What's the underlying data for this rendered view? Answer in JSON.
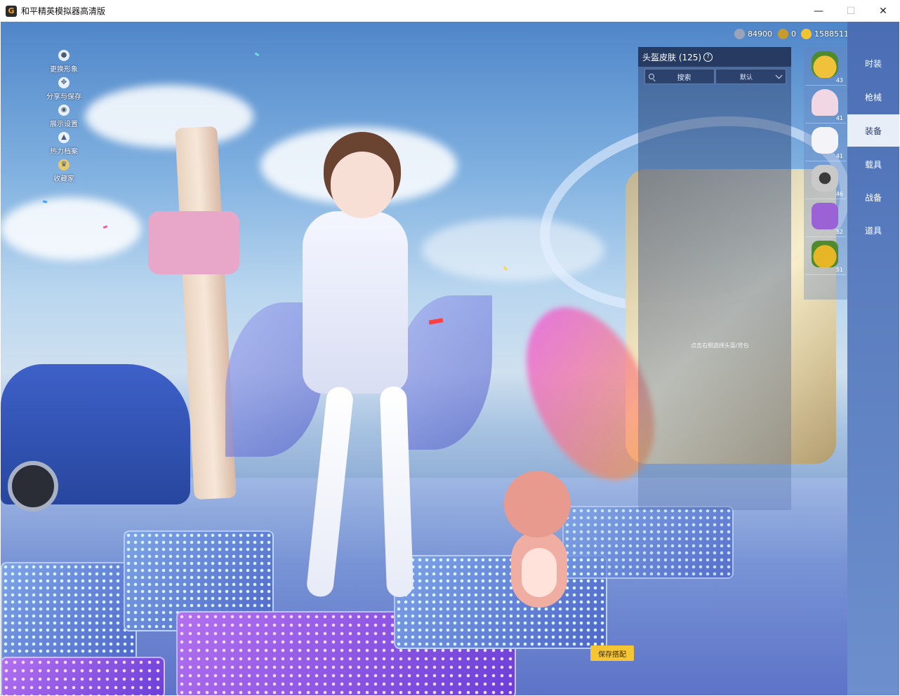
{
  "window": {
    "title": "和平精英模拟器高清版",
    "app_icon_glyph": "G",
    "minimize_glyph": "—",
    "maximize_glyph": "☐",
    "close_glyph": "✕"
  },
  "left_menu": [
    {
      "label": "更换形象",
      "icon": "person-icon"
    },
    {
      "label": "分享与保存",
      "icon": "share-icon"
    },
    {
      "label": "展示设置",
      "icon": "eye-icon"
    },
    {
      "label": "热力档案",
      "icon": "flame-icon"
    },
    {
      "label": "收藏家",
      "icon": "collector-icon"
    }
  ],
  "currency": [
    {
      "value": "84900",
      "icon": "silver-coin-icon",
      "color": "#9aa4b8"
    },
    {
      "value": "0",
      "icon": "gold-badge-icon",
      "color": "#c99a2e"
    },
    {
      "value": "1588511",
      "icon": "gold-coin-icon",
      "color": "#f1c232"
    }
  ],
  "skin_panel": {
    "title": "头盔皮肤 (125)",
    "search_placeholder": "搜索",
    "sort_value": "默认",
    "hint": "点击右侧选择头盔/背包"
  },
  "item_slots": [
    {
      "level": "43",
      "icon": "pineapple-helmet-icon",
      "color": "#f0c23a"
    },
    {
      "level": "41",
      "icon": "pig-helmet-icon",
      "color": "#f1d6e4"
    },
    {
      "level": "41",
      "icon": "white-helmet-icon",
      "color": "#f4f4f8"
    },
    {
      "level": "46",
      "icon": "knight-helmet-icon",
      "color": "#c9c9c9"
    },
    {
      "level": "52",
      "icon": "purple-backpack-icon",
      "color": "#9b62d6"
    },
    {
      "level": "51",
      "icon": "pineapple-backpack-icon",
      "color": "#e7b626"
    }
  ],
  "categories": [
    {
      "label": "时装",
      "active": false
    },
    {
      "label": "枪械",
      "active": false
    },
    {
      "label": "装备",
      "active": true
    },
    {
      "label": "载具",
      "active": false
    },
    {
      "label": "战备",
      "active": false
    },
    {
      "label": "道具",
      "active": false
    }
  ],
  "save_button": "保存搭配",
  "colors": {
    "accent_yellow": "#f5c533",
    "nav_blue": "#4a6db4",
    "active_tab_bg": "#e8eef8"
  }
}
